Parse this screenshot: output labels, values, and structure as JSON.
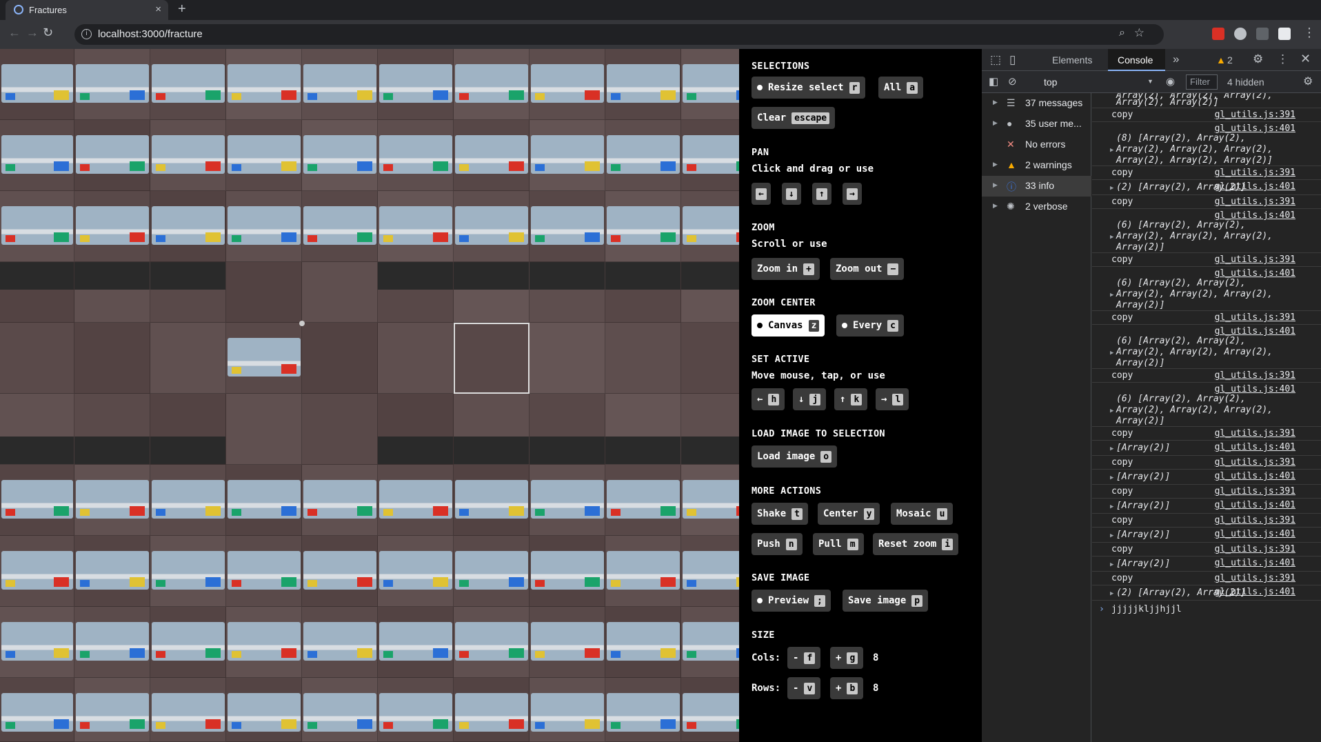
{
  "browser": {
    "tab_title": "Fractures",
    "new_tab": "+",
    "close": "×",
    "url": "localhost:3000/fracture"
  },
  "panel": {
    "selections": {
      "heading": "SELECTIONS",
      "resize": {
        "label": "Resize select",
        "key": "r"
      },
      "all": {
        "label": "All",
        "key": "a"
      },
      "clear": {
        "label": "Clear",
        "key": "escape"
      }
    },
    "pan": {
      "heading": "PAN",
      "sub": "Click and drag or use",
      "keys": [
        "←",
        "↓",
        "↑",
        "→"
      ]
    },
    "zoom": {
      "heading": "ZOOM",
      "sub": "Scroll or use",
      "zoom_in": {
        "label": "Zoom in",
        "key": "+"
      },
      "zoom_out": {
        "label": "Zoom out",
        "key": "−"
      }
    },
    "zoom_center": {
      "heading": "ZOOM CENTER",
      "canvas": {
        "label": "Canvas",
        "key": "z"
      },
      "every": {
        "label": "Every",
        "key": "c"
      }
    },
    "set_active": {
      "heading": "SET ACTIVE",
      "sub": "Move mouse, tap, or use",
      "keys": [
        {
          "label": "←",
          "key": "h"
        },
        {
          "label": "↓",
          "key": "j"
        },
        {
          "label": "↑",
          "key": "k"
        },
        {
          "label": "→",
          "key": "l"
        }
      ]
    },
    "load_image": {
      "heading": "LOAD IMAGE TO SELECTION",
      "load": {
        "label": "Load image",
        "key": "o"
      }
    },
    "more_actions": {
      "heading": "MORE ACTIONS",
      "shake": {
        "label": "Shake",
        "key": "t"
      },
      "center": {
        "label": "Center",
        "key": "y"
      },
      "mosaic": {
        "label": "Mosaic",
        "key": "u"
      },
      "push": {
        "label": "Push",
        "key": "n"
      },
      "pull": {
        "label": "Pull",
        "key": "m"
      },
      "reset_zoom": {
        "label": "Reset zoom",
        "key": "i"
      }
    },
    "save_image": {
      "heading": "SAVE IMAGE",
      "preview": {
        "label": "Preview",
        "key": ";"
      },
      "save": {
        "label": "Save image",
        "key": "p"
      }
    },
    "size": {
      "heading": "SIZE",
      "cols_label": "Cols:",
      "cols_minus": {
        "label": "-",
        "key": "f"
      },
      "cols_plus": {
        "label": "+",
        "key": "g"
      },
      "cols_value": "8",
      "rows_label": "Rows:",
      "rows_minus": {
        "label": "-",
        "key": "v"
      },
      "rows_plus": {
        "label": "+",
        "key": "b"
      },
      "rows_value": "8"
    }
  },
  "devtools": {
    "tabs": [
      "Elements",
      "Console"
    ],
    "more_tabs": "»",
    "warning_count": "2",
    "context": "top",
    "filter_placeholder": "Filter",
    "hidden": "4 hidden",
    "sidebar": [
      {
        "label": "37 messages",
        "icon": "list-icon"
      },
      {
        "label": "35 user me...",
        "icon": "user-icon"
      },
      {
        "label": "No errors",
        "icon": "error-icon"
      },
      {
        "label": "2 warnings",
        "icon": "warning-icon"
      },
      {
        "label": "33 info",
        "icon": "info-icon"
      },
      {
        "label": "2 verbose",
        "icon": "verbose-icon"
      }
    ],
    "log": [
      {
        "msg": "Array(2), Array(2)]",
        "src": "",
        "italic": true,
        "tri": false,
        "cont": true
      },
      {
        "msg": "copy",
        "src": "gl_utils.js:391",
        "italic": false,
        "tri": false
      },
      {
        "msg": "(8) [Array(2), Array(2), Array(2), Array(2), Array(2), Array(2), Array(2), Array(2)]",
        "src": "gl_utils.js:401",
        "italic": true,
        "tri": true
      },
      {
        "msg": "copy",
        "src": "gl_utils.js:391",
        "italic": false,
        "tri": false
      },
      {
        "msg": "(2) [Array(2), Array(2)]",
        "src": "gl_utils.js:401",
        "italic": true,
        "tri": true
      },
      {
        "msg": "copy",
        "src": "gl_utils.js:391",
        "italic": false,
        "tri": false
      },
      {
        "msg": "(6) [Array(2), Array(2), Array(2), Array(2), Array(2), Array(2)]",
        "src": "gl_utils.js:401",
        "italic": true,
        "tri": true
      },
      {
        "msg": "copy",
        "src": "gl_utils.js:391",
        "italic": false,
        "tri": false
      },
      {
        "msg": "(6) [Array(2), Array(2), Array(2), Array(2), Array(2), Array(2)]",
        "src": "gl_utils.js:401",
        "italic": true,
        "tri": true
      },
      {
        "msg": "copy",
        "src": "gl_utils.js:391",
        "italic": false,
        "tri": false
      },
      {
        "msg": "(6) [Array(2), Array(2), Array(2), Array(2), Array(2), Array(2)]",
        "src": "gl_utils.js:401",
        "italic": true,
        "tri": true
      },
      {
        "msg": "copy",
        "src": "gl_utils.js:391",
        "italic": false,
        "tri": false
      },
      {
        "msg": "(6) [Array(2), Array(2), Array(2), Array(2), Array(2), Array(2)]",
        "src": "gl_utils.js:401",
        "italic": true,
        "tri": true
      },
      {
        "msg": "copy",
        "src": "gl_utils.js:391",
        "italic": false,
        "tri": false
      },
      {
        "msg": "[Array(2)]",
        "src": "gl_utils.js:401",
        "italic": true,
        "tri": true
      },
      {
        "msg": "copy",
        "src": "gl_utils.js:391",
        "italic": false,
        "tri": false
      },
      {
        "msg": "[Array(2)]",
        "src": "gl_utils.js:401",
        "italic": true,
        "tri": true
      },
      {
        "msg": "copy",
        "src": "gl_utils.js:391",
        "italic": false,
        "tri": false
      },
      {
        "msg": "[Array(2)]",
        "src": "gl_utils.js:401",
        "italic": true,
        "tri": true
      },
      {
        "msg": "copy",
        "src": "gl_utils.js:391",
        "italic": false,
        "tri": false
      },
      {
        "msg": "[Array(2)]",
        "src": "gl_utils.js:401",
        "italic": true,
        "tri": true
      },
      {
        "msg": "copy",
        "src": "gl_utils.js:391",
        "italic": false,
        "tri": false
      },
      {
        "msg": "[Array(2)]",
        "src": "gl_utils.js:401",
        "italic": true,
        "tri": true
      },
      {
        "msg": "copy",
        "src": "gl_utils.js:391",
        "italic": false,
        "tri": false
      },
      {
        "msg": "(2) [Array(2), Array(2)]",
        "src": "gl_utils.js:401",
        "italic": true,
        "tri": true
      }
    ],
    "prompt_input": "jjjjjkljjhjjl",
    "first_line": "Array(2), Array(2), Array(2),"
  },
  "colors": {
    "accent": "#8ab4f8",
    "warning": "#f9ab00",
    "error": "#f28b82",
    "info": "#3b78e7"
  }
}
